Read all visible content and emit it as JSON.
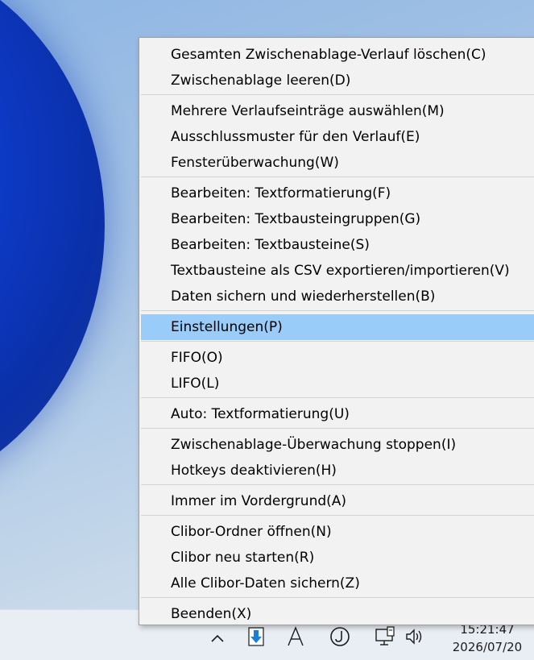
{
  "menu": {
    "items": [
      {
        "label": "Gesamten Zwischenablage-Verlauf löschen(C)"
      },
      {
        "label": "Zwischenablage leeren(D)"
      },
      {
        "label": "Mehrere Verlaufseinträge auswählen(M)"
      },
      {
        "label": "Ausschlussmuster für den Verlauf(E)"
      },
      {
        "label": "Fensterüberwachung(W)"
      },
      {
        "label": "Bearbeiten: Textformatierung(F)"
      },
      {
        "label": "Bearbeiten: Textbausteingruppen(G)"
      },
      {
        "label": "Bearbeiten: Textbausteine(S)"
      },
      {
        "label": "Textbausteine als CSV exportieren/importieren(V)"
      },
      {
        "label": "Daten sichern und wiederherstellen(B)"
      },
      {
        "label": "Einstellungen(P)",
        "highlighted": true
      },
      {
        "label": "FIFO(O)"
      },
      {
        "label": "LIFO(L)"
      },
      {
        "label": "Auto: Textformatierung(U)",
        "has_submenu": true
      },
      {
        "label": "Zwischenablage-Überwachung stoppen(I)"
      },
      {
        "label": "Hotkeys deaktivieren(H)"
      },
      {
        "label": "Immer im Vordergrund(A)"
      },
      {
        "label": "Clibor-Ordner öffnen(N)"
      },
      {
        "label": "Clibor neu starten(R)"
      },
      {
        "label": "Alle Clibor-Daten sichern(Z)"
      },
      {
        "label": "Beenden(X)"
      }
    ]
  },
  "taskbar": {
    "time": "15:21:47",
    "date": "2026/07/20",
    "tray_icons": [
      "chevron-up-icon",
      "clibor-download-icon",
      "ime-a-icon",
      "j-circle-icon",
      "network-monitor-icon",
      "volume-icon"
    ]
  },
  "colors": {
    "menu_bg": "#f2f2f2",
    "highlight": "#99ccf8",
    "separator": "#d2d2d2"
  }
}
